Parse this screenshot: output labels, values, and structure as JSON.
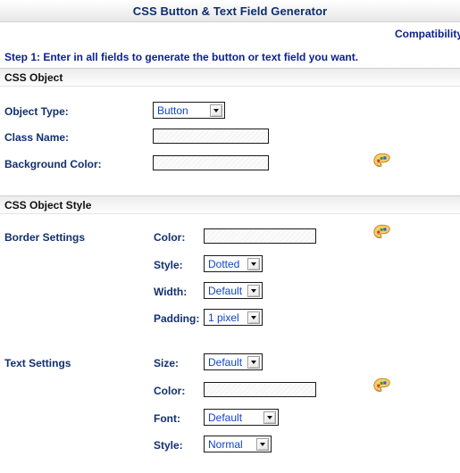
{
  "window": {
    "title": "CSS Button & Text Field Generator"
  },
  "topbar": {
    "compatibility_label": "Compatibility"
  },
  "instructions": {
    "step_text": "Step 1: Enter in all fields to generate the button or text field you want."
  },
  "sections": [
    {
      "id": "css-object",
      "title": "CSS Object",
      "fields": [
        {
          "id": "object-type",
          "label": "Object Type:",
          "control": "select",
          "value": "Button"
        },
        {
          "id": "class-name",
          "label": "Class Name:",
          "control": "text",
          "value": "",
          "placeholder": ""
        },
        {
          "id": "background-color",
          "label": "Background Color:",
          "control": "text",
          "value": "",
          "placeholder": "",
          "has_palette": true
        }
      ]
    },
    {
      "id": "css-object-style",
      "title": "CSS Object Style",
      "groups": [
        {
          "id": "border-settings",
          "label": "Border Settings",
          "fields": [
            {
              "id": "border-color",
              "label": "Color:",
              "control": "text",
              "value": "",
              "placeholder": "",
              "has_palette": true
            },
            {
              "id": "border-style",
              "label": "Style:",
              "control": "select",
              "value": "Dotted"
            },
            {
              "id": "border-width",
              "label": "Width:",
              "control": "select",
              "value": "Default"
            },
            {
              "id": "border-padding",
              "label": "Padding:",
              "control": "select",
              "value": "1 pixel"
            }
          ]
        },
        {
          "id": "text-settings",
          "label": "Text Settings",
          "fields": [
            {
              "id": "text-size",
              "label": "Size:",
              "control": "select",
              "value": "Default"
            },
            {
              "id": "text-color",
              "label": "Color:",
              "control": "text",
              "value": "",
              "placeholder": "",
              "has_palette": true
            },
            {
              "id": "text-font",
              "label": "Font:",
              "control": "select",
              "value": "Default"
            },
            {
              "id": "text-style",
              "label": "Style:",
              "control": "select",
              "value": "Normal"
            }
          ]
        }
      ]
    }
  ],
  "icons": {
    "palette": "color-palette-icon",
    "dropdown_arrow": "chevron-down-icon"
  },
  "colors": {
    "title_text": "#0d2d6b",
    "link_text": "#0b1f8f",
    "label_text": "#12306e",
    "select_value_text": "#1243c8",
    "section_bar_text": "#111111",
    "input_border": "#1a1a1a"
  }
}
